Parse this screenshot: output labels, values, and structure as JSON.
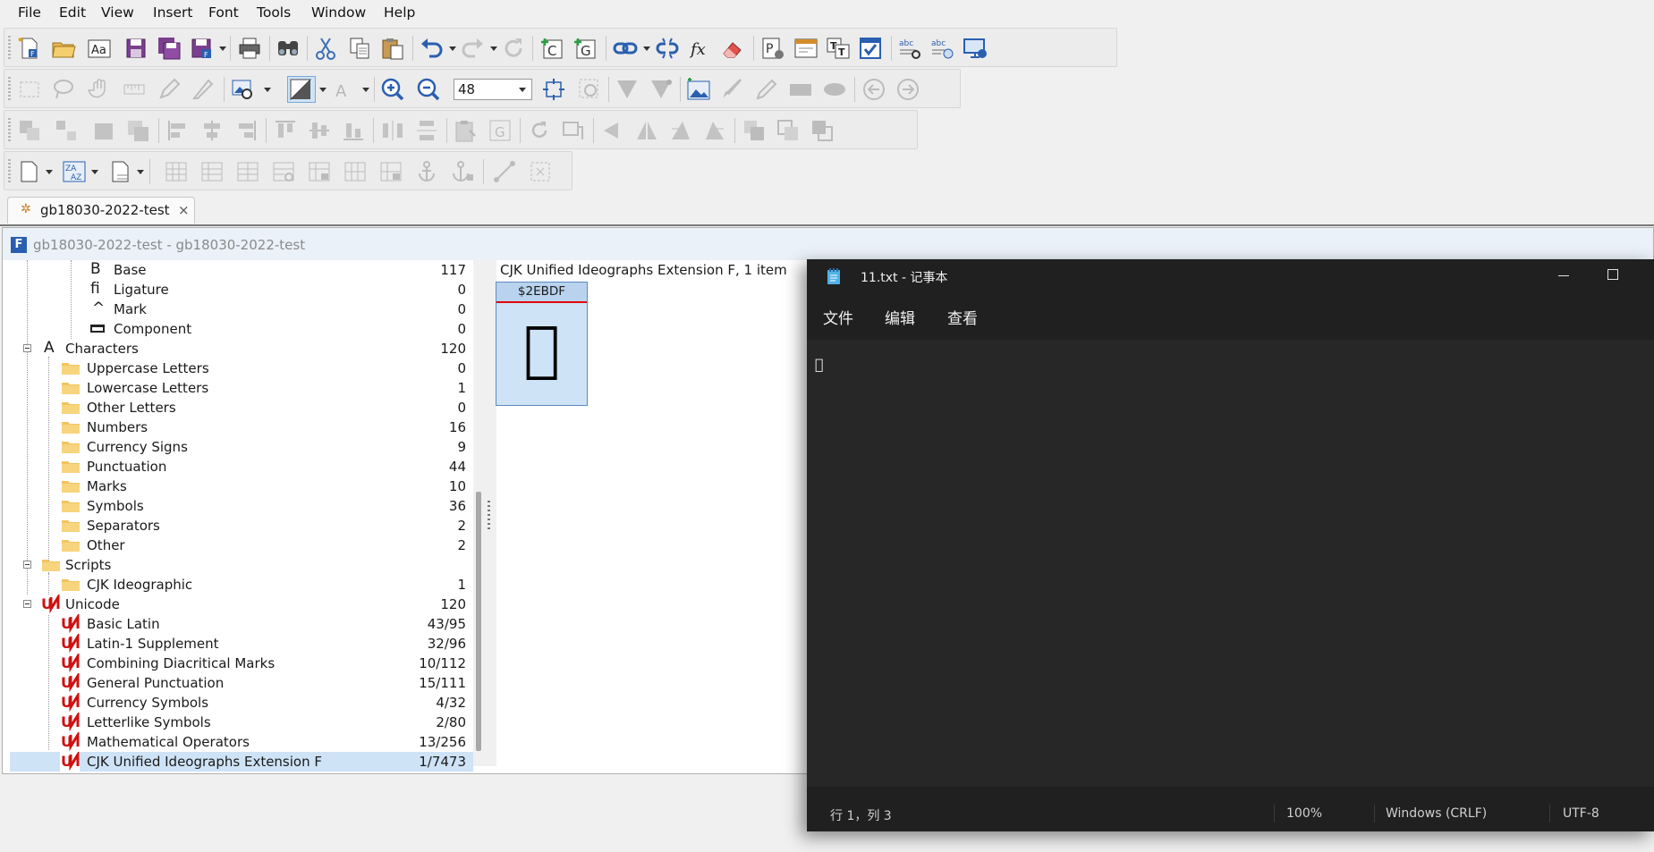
{
  "menubar": {
    "items": [
      "File",
      "Edit",
      "View",
      "Insert",
      "Font",
      "Tools",
      "Window",
      "Help"
    ]
  },
  "toolbar": {
    "zoom_value": "48"
  },
  "doc_tab": {
    "label": "gb18030-2022-test",
    "close": "×"
  },
  "font_window": {
    "title": "gb18030-2022-test - gb18030-2022-test"
  },
  "tree": {
    "rows": [
      {
        "label": "Base",
        "count": "117",
        "icon": "B"
      },
      {
        "label": "Ligature",
        "count": "0",
        "icon": "ﬁ"
      },
      {
        "label": "Mark",
        "count": "0",
        "icon": "^"
      },
      {
        "label": "Component",
        "count": "0",
        "icon": "component-icon"
      },
      {
        "label": "Characters",
        "count": "120",
        "icon": "A"
      },
      {
        "label": "Uppercase Letters",
        "count": "0"
      },
      {
        "label": "Lowercase Letters",
        "count": "1"
      },
      {
        "label": "Other Letters",
        "count": "0"
      },
      {
        "label": "Numbers",
        "count": "16"
      },
      {
        "label": "Currency Signs",
        "count": "9"
      },
      {
        "label": "Punctuation",
        "count": "44"
      },
      {
        "label": "Marks",
        "count": "10"
      },
      {
        "label": "Symbols",
        "count": "36"
      },
      {
        "label": "Separators",
        "count": "2"
      },
      {
        "label": "Other",
        "count": "2"
      },
      {
        "label": "Scripts",
        "count": ""
      },
      {
        "label": "CJK Ideographic",
        "count": "1"
      },
      {
        "label": "Unicode",
        "count": "120"
      },
      {
        "label": "Basic Latin",
        "count": "43/95"
      },
      {
        "label": "Latin-1 Supplement",
        "count": "32/96"
      },
      {
        "label": "Combining Diacritical Marks",
        "count": "10/112"
      },
      {
        "label": "General Punctuation",
        "count": "15/111"
      },
      {
        "label": "Currency Symbols",
        "count": "4/32"
      },
      {
        "label": "Letterlike Symbols",
        "count": "2/80"
      },
      {
        "label": "Mathematical Operators",
        "count": "13/256"
      },
      {
        "label": "CJK Unified Ideographs Extension F",
        "count": "1/7473"
      }
    ]
  },
  "glyph_panel": {
    "header": "CJK Unified Ideographs Extension F, 1 item",
    "cell_code": "$2EBDF",
    "cell_char": "𮯟"
  },
  "notepad": {
    "title": "11.txt - 记事本",
    "menu": [
      "文件",
      "编辑",
      "查看"
    ],
    "content": "𮯟",
    "status": {
      "position": "行 1，列 3",
      "zoom": "100%",
      "line_ending": "Windows (CRLF)",
      "encoding": "UTF-8"
    }
  },
  "colors": {
    "selection": "#cfe3f7",
    "notepad_bg": "#202020",
    "glyph_cell_marker": "#e00000"
  }
}
